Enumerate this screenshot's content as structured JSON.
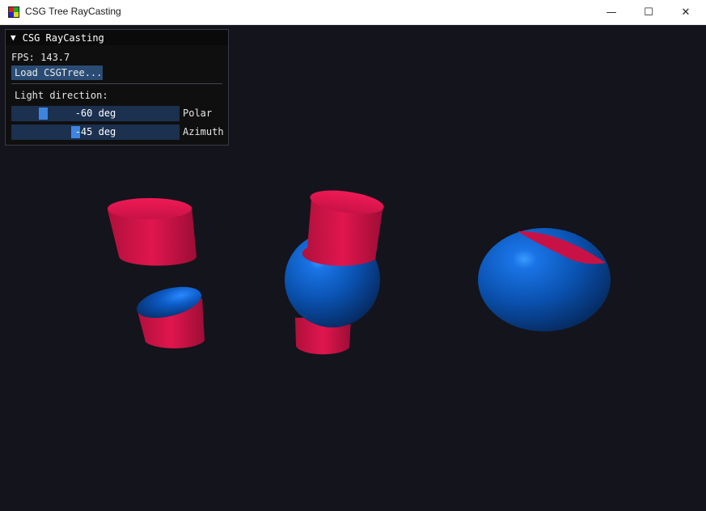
{
  "window": {
    "title": "CSG Tree RayCasting",
    "minimize_glyph": "—",
    "maximize_glyph": "☐",
    "close_glyph": "✕"
  },
  "panel": {
    "title": "CSG RayCasting",
    "collapse_glyph": "▼",
    "fps_text": "FPS: 143.7",
    "load_button_label": "Load CSGTree...",
    "light_direction_label": "Light direction:",
    "sliders": [
      {
        "label": "Polar",
        "value_text": "-60 deg",
        "value": -60,
        "min": -90,
        "max": 90
      },
      {
        "label": "Azimuth",
        "value_text": "-45 deg",
        "value": -45,
        "min": -180,
        "max": 180
      }
    ]
  },
  "colors": {
    "background": "#14141c",
    "blue_surface": "#0a52b0",
    "red_surface": "#e0164e",
    "slider_frame": "#1c304f",
    "slider_grab": "#3d85e0",
    "button": "#2a4c74"
  }
}
